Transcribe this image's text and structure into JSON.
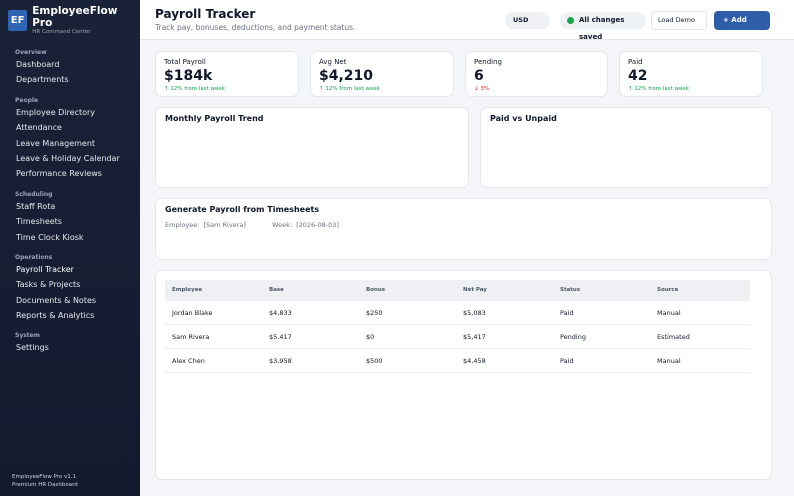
{
  "brand": {
    "logo": "EF",
    "name": "EmployeeFlow Pro",
    "subtitle": "HR Command Center"
  },
  "sidebar": {
    "sections": [
      {
        "title": "Overview",
        "items": [
          "Dashboard",
          "Departments"
        ]
      },
      {
        "title": "People",
        "items": [
          "Employee Directory",
          "Attendance",
          "Leave Management",
          "Leave & Holiday Calendar",
          "Performance Reviews"
        ]
      },
      {
        "title": "Scheduling",
        "items": [
          "Staff Rota",
          "Timesheets",
          "Time Clock Kiosk"
        ]
      },
      {
        "title": "Operations",
        "items": [
          "Payroll Tracker",
          "Tasks & Projects",
          "Documents & Notes",
          "Reports & Analytics"
        ]
      },
      {
        "title": "System",
        "items": [
          "Settings"
        ]
      }
    ],
    "active": "Payroll Tracker",
    "footer": {
      "version": "EmployeeFlow Pro v1.1",
      "tagline": "Premium HR Dashboard"
    }
  },
  "header": {
    "title": "Payroll Tracker",
    "subtitle": "Track pay, bonuses, deductions, and payment status.",
    "currency": "USD",
    "save_status": "All changes saved",
    "load_demo": "Load Demo",
    "add_label": "+ Add"
  },
  "stats": [
    {
      "label": "Total Payroll",
      "value": "$184k",
      "delta": "↑ 12% from last week",
      "trend": "up"
    },
    {
      "label": "Avg Net",
      "value": "$4,210",
      "delta": "↑ 12% from last week",
      "trend": "up"
    },
    {
      "label": "Pending",
      "value": "6",
      "delta": "↓ 3%",
      "trend": "down"
    },
    {
      "label": "Paid",
      "value": "42",
      "delta": "↑ 12% from last week",
      "trend": "up"
    }
  ],
  "charts": {
    "trend_title": "Monthly Payroll Trend",
    "paid_title": "Paid vs Unpaid"
  },
  "generate": {
    "title": "Generate Payroll from Timesheets",
    "employee_label": "Employee:",
    "employee_value": "[Sam Rivera]",
    "week_label": "Week:",
    "week_value": "[2026-08-03]"
  },
  "table": {
    "columns": [
      "Employee",
      "Base",
      "Bonus",
      "Net Pay",
      "Status",
      "Source"
    ],
    "rows": [
      [
        "Jordan Blake",
        "$4,833",
        "$250",
        "$5,083",
        "Paid",
        "Manual"
      ],
      [
        "Sam Rivera",
        "$5,417",
        "$0",
        "$5,417",
        "Pending",
        "Estimated"
      ],
      [
        "Alex Chen",
        "$3,958",
        "$500",
        "$4,458",
        "Paid",
        "Manual"
      ]
    ]
  },
  "colors": {
    "accent": "#2f5ea8",
    "sidebar": "#1a2238",
    "up": "#16a34a",
    "down": "#dc2626"
  }
}
